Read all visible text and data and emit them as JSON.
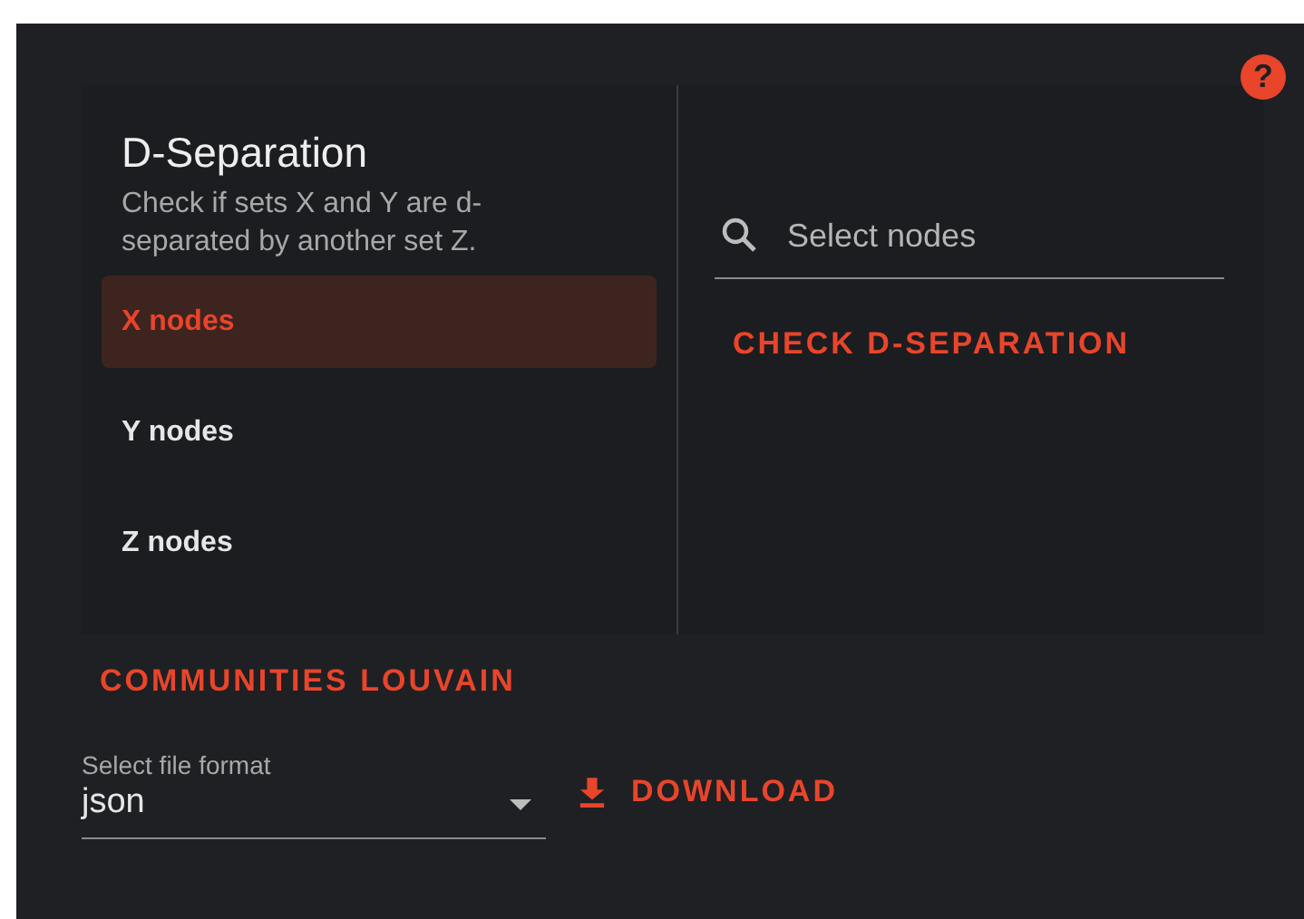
{
  "help": {
    "label": "?"
  },
  "dseparation": {
    "title": "D-Separation",
    "description": "Check if sets X and Y are d-separated by another set Z.",
    "sets": [
      {
        "label": "X nodes",
        "selected": true
      },
      {
        "label": "Y nodes",
        "selected": false
      },
      {
        "label": "Z nodes",
        "selected": false
      }
    ],
    "search": {
      "placeholder": "Select nodes"
    },
    "check_button": "CHECK D-SEPARATION"
  },
  "communities_button": "COMMUNITIES LOUVAIN",
  "export": {
    "label": "Select file format",
    "value": "json",
    "download_button": "DOWNLOAD"
  }
}
